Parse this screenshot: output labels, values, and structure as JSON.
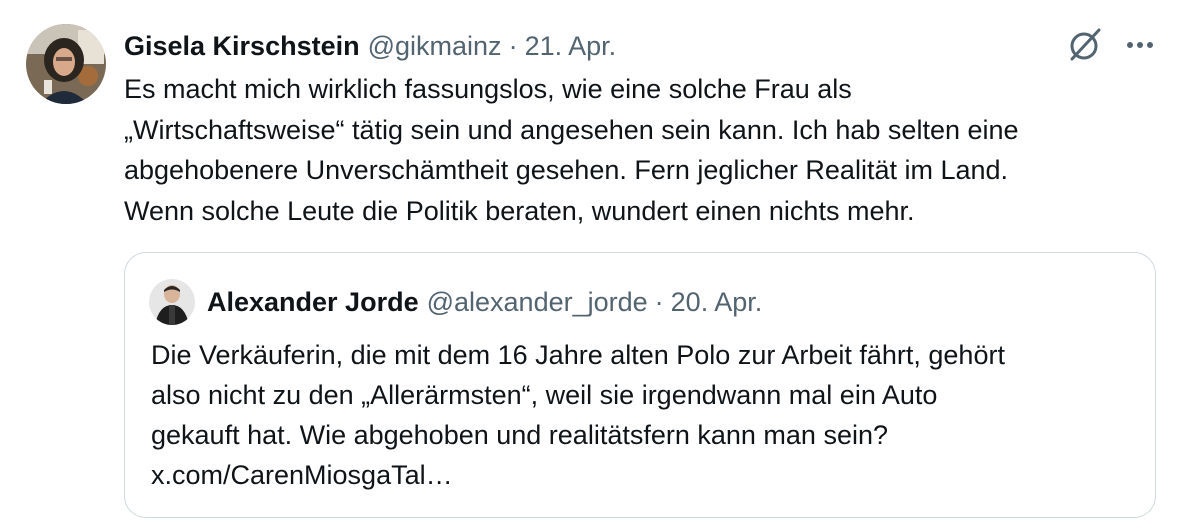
{
  "tweet": {
    "author": {
      "name": "Gisela Kirschstein",
      "handle": "@gikmainz",
      "date": "21. Apr."
    },
    "separator": "·",
    "text_lines": [
      "Es macht mich wirklich fassungslos, wie eine solche Frau als",
      "„Wirtschaftsweise“ tätig sein und angesehen sein kann. Ich hab selten eine",
      "abgehobenere Unverschämtheit gesehen. Fern jeglicher Realität im Land.",
      "Wenn solche Leute die Politik beraten, wundert einen nichts mehr."
    ],
    "icons": {
      "grok": "grok-icon",
      "more": "more-icon"
    }
  },
  "quote": {
    "author": {
      "name": "Alexander Jorde",
      "handle": "@alexander_jorde",
      "date": "20. Apr."
    },
    "separator": "·",
    "text_lines": [
      "Die Verkäuferin, die mit dem 16 Jahre alten Polo zur Arbeit fährt, gehört",
      "also nicht zu den „Allerärmsten“, weil sie irgendwann mal ein Auto",
      "gekauft hat. Wie abgehoben und realitätsfern kann man sein?"
    ],
    "link": "x.com/CarenMiosgaTal…"
  },
  "colors": {
    "text": "#0f1419",
    "secondary": "#536471",
    "border": "#cfd9de"
  }
}
